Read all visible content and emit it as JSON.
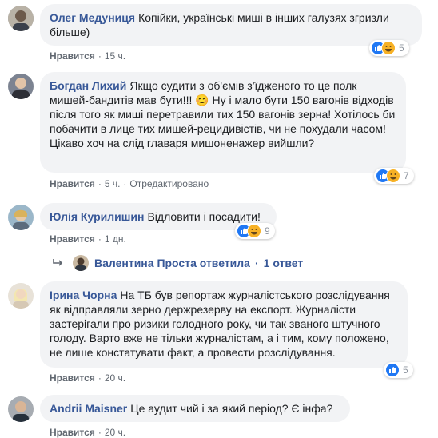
{
  "comments": [
    {
      "author": "Олег Медуниця",
      "text": "Копійки, українські миші в інших галузях згризли більше)",
      "like_label": "Нравится",
      "time": "15 ч.",
      "edited": "",
      "reactions": "5"
    },
    {
      "author": "Богдан Лихий",
      "text": "Якщо судити з об'ємів з'їдженого то це полк мишей-бандитів мав бути!!! 😊 Ну і мало бути 150 вагонів відходів після того як миші перетравили тих 150 вагонів зерна! Хотілось би побачити в лице тих мишей-рецидивістів, чи не похудали часом! Цікаво хоч на слід главаря мишоненажер вийшли?",
      "like_label": "Нравится",
      "time": "5 ч.",
      "edited": "Отредактировано",
      "reactions": "7"
    },
    {
      "author": "Юлія Курилишин",
      "text": "Відловити і посадити!",
      "like_label": "Нравится",
      "time": "1 дн.",
      "edited": "",
      "reactions": "9",
      "reply": {
        "name": "Валентина Проста ответила",
        "count": "1 ответ"
      }
    },
    {
      "author": "Ірина Чорна",
      "text": "На ТБ був репортаж журналістського розслідування як відправляли зерно держрезерву на експорт. Журналісти застерігали про ризики голодного року, чи так званого штучного голоду. Варто вже не тільки журналістам, а і тим, кому положено, не лише констатувати факт, а провести розслідування.",
      "like_label": "Нравится",
      "time": "20 ч.",
      "edited": "",
      "reactions": "5"
    },
    {
      "author": "Andrii Maisner",
      "text": "Це аудит чий і за який період? Є інфа?",
      "like_label": "Нравится",
      "time": "20 ч.",
      "edited": "",
      "reactions": ""
    }
  ],
  "colors": {
    "author": "#385898",
    "bubble": "#f2f3f5",
    "meta": "#606770",
    "like_reaction": "#2078f4",
    "haha_reaction": "#f7b125"
  },
  "icons": [
    "like-reaction-icon",
    "haha-reaction-icon",
    "reply-arrow-icon"
  ]
}
